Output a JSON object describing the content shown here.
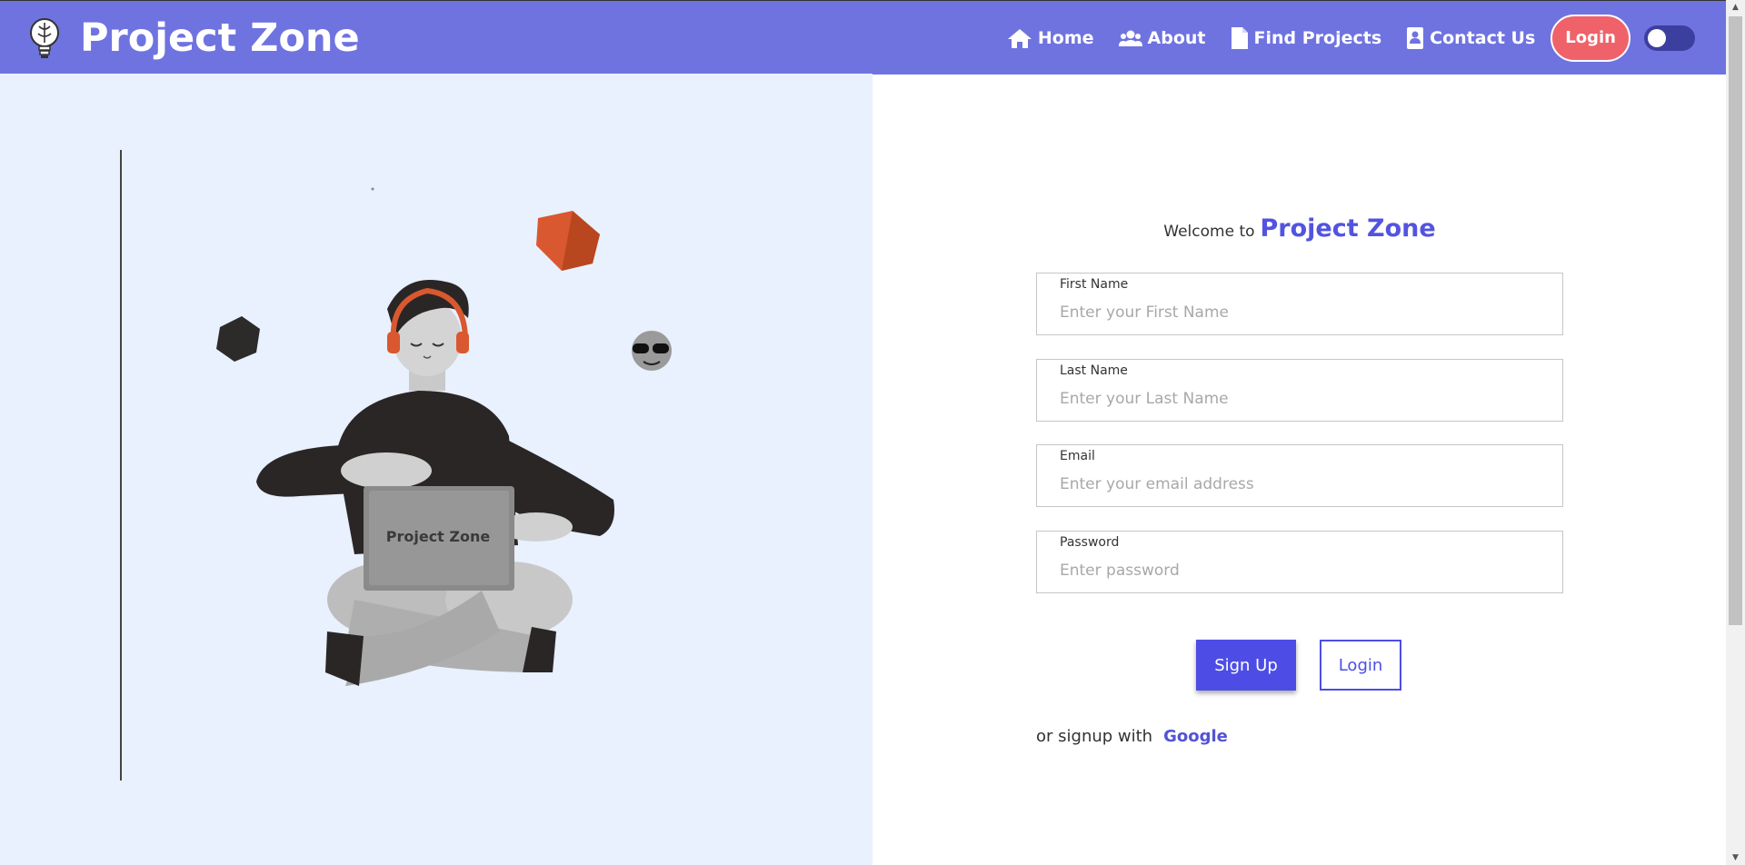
{
  "navbar": {
    "brand": "Project Zone",
    "links": [
      {
        "label": "Home",
        "icon": "home-icon"
      },
      {
        "label": "About",
        "icon": "users-icon"
      },
      {
        "label": "Find Projects",
        "icon": "file-icon"
      },
      {
        "label": "Contact Us",
        "icon": "contact-card-icon"
      }
    ],
    "login_label": "Login",
    "theme_toggle": "off"
  },
  "illustration": {
    "laptop_label": "Project Zone"
  },
  "form": {
    "welcome_text": "Welcome to",
    "welcome_brand": "Project Zone",
    "fields": [
      {
        "label": "First Name",
        "placeholder": "Enter your First Name",
        "value": ""
      },
      {
        "label": "Last Name",
        "placeholder": "Enter your Last Name",
        "value": ""
      },
      {
        "label": "Email",
        "placeholder": "Enter your email address",
        "value": ""
      },
      {
        "label": "Password",
        "placeholder": "Enter password",
        "value": ""
      }
    ],
    "signup_label": "Sign Up",
    "login_label": "Login",
    "alt_text": "or signup with",
    "google_label": "Google"
  },
  "colors": {
    "navbar": "#6f73e0",
    "accent": "#4d4de6",
    "login_pill": "#f0626a",
    "left_panel": "#e8f1fd"
  }
}
